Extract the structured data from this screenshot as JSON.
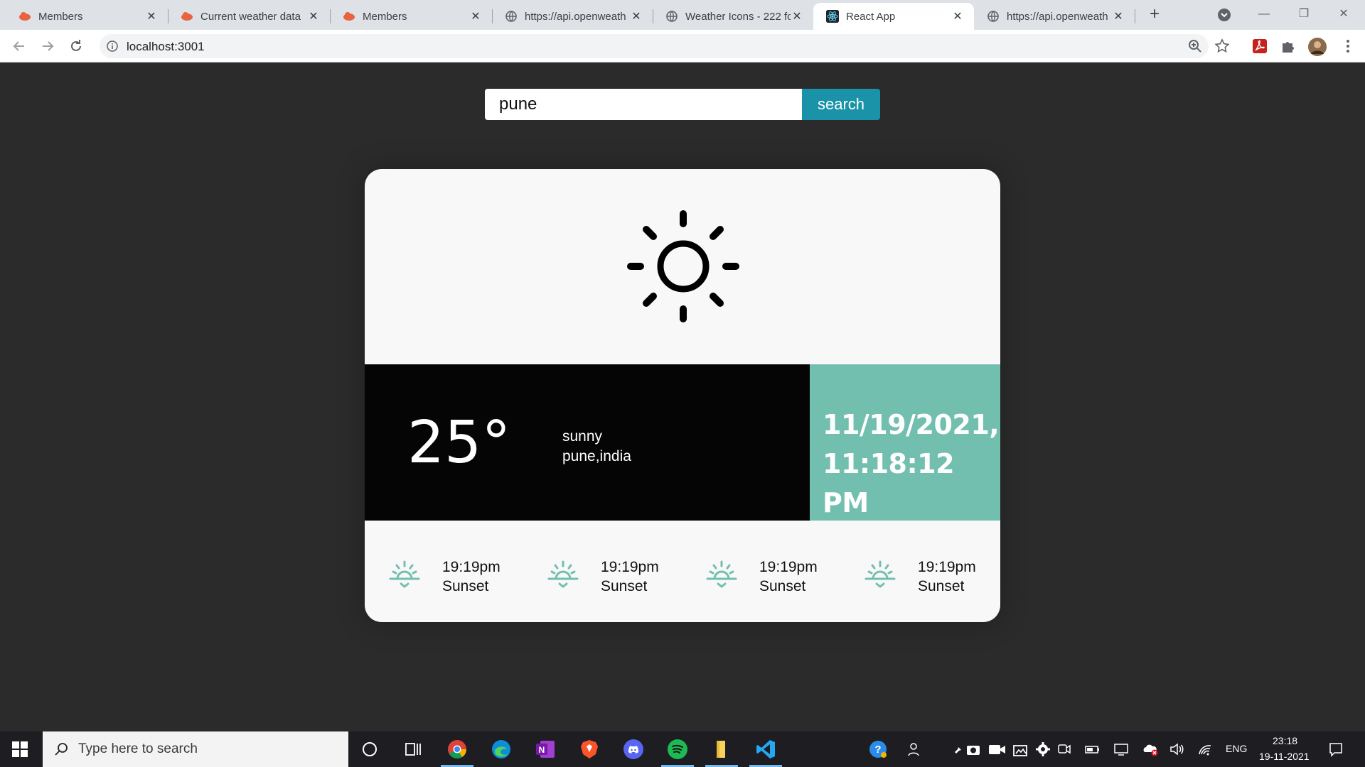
{
  "browser": {
    "tabs": [
      {
        "title": "Members",
        "favicon": "red-cloud-icon",
        "active": false
      },
      {
        "title": "Current weather data",
        "favicon": "red-cloud-icon",
        "active": false
      },
      {
        "title": "Members",
        "favicon": "red-cloud-icon",
        "active": false
      },
      {
        "title": "https://api.openweath",
        "favicon": "globe-icon",
        "active": false
      },
      {
        "title": "Weather Icons - 222 fo",
        "favicon": "globe-icon",
        "active": false
      },
      {
        "title": "React App",
        "favicon": "react-icon",
        "active": true
      },
      {
        "title": "https://api.openweath",
        "favicon": "globe-icon",
        "active": false
      }
    ],
    "address_bar": {
      "url": "localhost:3001"
    }
  },
  "search": {
    "value": "pune",
    "button_label": "search"
  },
  "weather": {
    "icon": "sun-icon",
    "temperature": "25°",
    "condition": "sunny",
    "location": "pune,india",
    "datetime_line1": "11/19/2021,",
    "datetime_line2": "11:18:12 PM"
  },
  "extra_info": [
    {
      "icon": "sunset-icon",
      "time": "19:19pm",
      "label": "Sunset"
    },
    {
      "icon": "sunset-icon",
      "time": "19:19pm",
      "label": "Sunset"
    },
    {
      "icon": "sunset-icon",
      "time": "19:19pm",
      "label": "Sunset"
    },
    {
      "icon": "sunset-icon",
      "time": "19:19pm",
      "label": "Sunset"
    }
  ],
  "taskbar": {
    "search_placeholder": "Type here to search",
    "language": "ENG",
    "time": "23:18",
    "date": "19-11-2021"
  },
  "colors": {
    "page_background": "#2b2b2b",
    "card_background": "#f8f8f8",
    "info_band": "#050505",
    "date_band": "#72bfb0",
    "search_button": "#1a93a9",
    "sunset_icon": "#72bfb0"
  }
}
